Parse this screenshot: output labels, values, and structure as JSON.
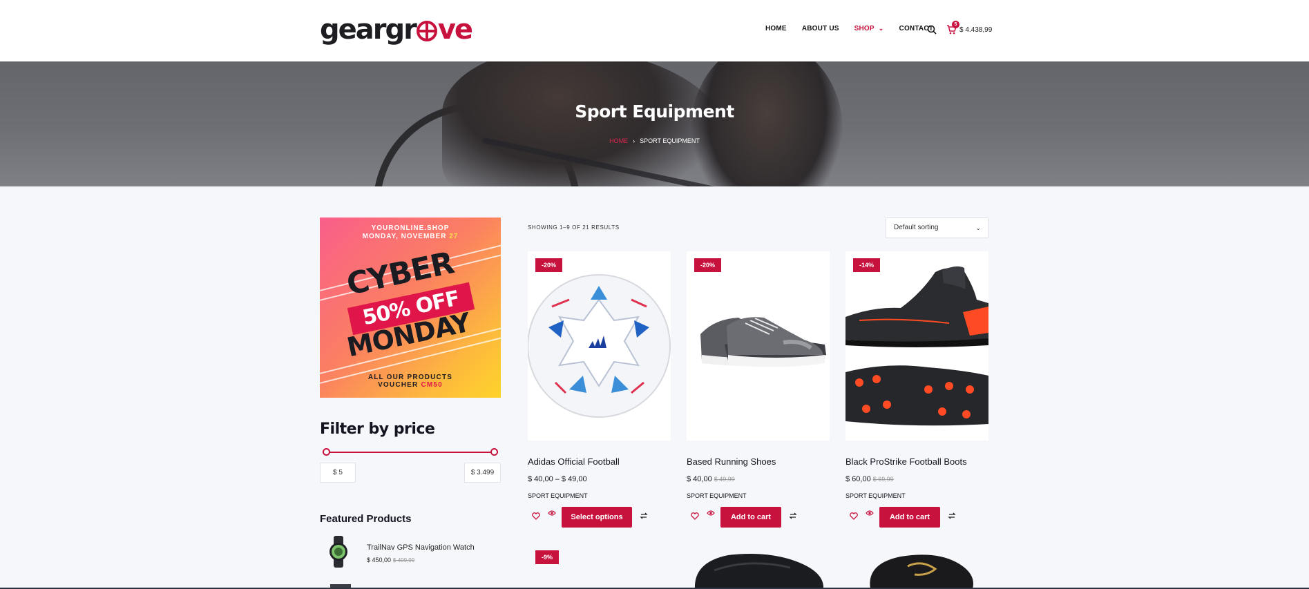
{
  "brand": {
    "logo_pre": "geargr",
    "logo_post": "ve"
  },
  "nav": {
    "items": [
      "HOME",
      "ABOUT US",
      "SHOP",
      "CONTACT"
    ],
    "active": "SHOP",
    "cart_count": "5",
    "cart_total": "$ 4.438,99"
  },
  "hero": {
    "title": "Sport Equipment",
    "breadcrumb_home": "HOME",
    "breadcrumb_sep": "›",
    "breadcrumb_current": "SPORT EQUIPMENT"
  },
  "banner": {
    "site": "YOURONLINE.SHOP",
    "date_prefix": "MONDAY, NOVEMBER",
    "date_day": "27",
    "line1": "CYBER",
    "line2": "50% OFF",
    "line3": "MONDAY",
    "bottom1": "ALL OUR PRODUCTS",
    "voucher_label": "VOUCHER",
    "voucher_code": "CM50"
  },
  "filter": {
    "title": "Filter by price",
    "min": "$ 5",
    "max": "$ 3.499",
    "min_level": 0.0,
    "max_level": 1.0
  },
  "featured": {
    "title": "Featured Products",
    "items": [
      {
        "name": "TrailNav GPS Navigation Watch",
        "price": "$ 450,00",
        "old_price": "$ 499,99"
      }
    ]
  },
  "shop": {
    "showing": "SHOWING 1–9 OF 21 RESULTS",
    "sort": "Default sorting",
    "products": [
      {
        "badge": "-20%",
        "name": "Adidas Official Football",
        "price": "$ 40,00 – $ 49,00",
        "old_price": "",
        "category": "SPORT EQUIPMENT",
        "button": "Select options"
      },
      {
        "badge": "-20%",
        "name": "Based Running Shoes",
        "price": "$ 40,00",
        "old_price": "$ 49,99",
        "category": "SPORT EQUIPMENT",
        "button": "Add to cart"
      },
      {
        "badge": "-14%",
        "name": "Black ProStrike Football Boots",
        "price": "$ 60,00",
        "old_price": "$ 69,99",
        "category": "SPORT EQUIPMENT",
        "button": "Add to cart"
      },
      {
        "badge": "-9%"
      }
    ]
  },
  "colors": {
    "accent": "#c8123e",
    "background": "#f6f7fa"
  }
}
